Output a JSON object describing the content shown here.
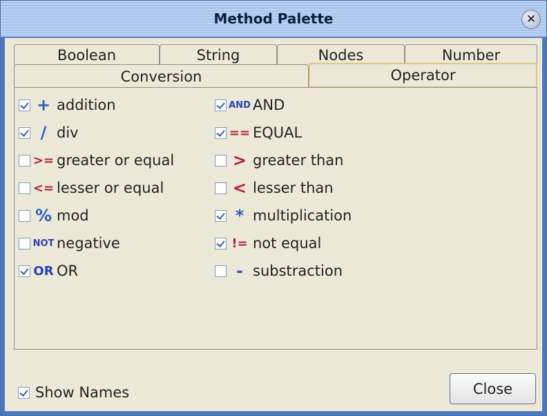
{
  "window": {
    "title": "Method Palette"
  },
  "tabs_row1": [
    "Boolean",
    "String",
    "Nodes",
    "Number"
  ],
  "tabs_row2": [
    "Conversion",
    "Operator"
  ],
  "selected_tab": "Operator",
  "left_items": [
    {
      "icon": "+",
      "icon_name": "plus-icon",
      "label": "addition",
      "checked": true,
      "color": "#2f5fc4"
    },
    {
      "icon": "/",
      "icon_name": "slash-icon",
      "label": "div",
      "checked": true,
      "color": "#2f5fc4"
    },
    {
      "icon": ">=",
      "icon_name": "greater-equal-icon",
      "label": "greater or equal",
      "checked": false,
      "color": "#b0203a"
    },
    {
      "icon": "<=",
      "icon_name": "lesser-equal-icon",
      "label": "lesser or equal",
      "checked": false,
      "color": "#b0203a"
    },
    {
      "icon": "%",
      "icon_name": "percent-icon",
      "label": "mod",
      "checked": false,
      "color": "#2f5fc4"
    },
    {
      "icon": "NOT",
      "icon_name": "not-icon",
      "label": "negative",
      "checked": false,
      "color": "#2a3fb0"
    },
    {
      "icon": "OR",
      "icon_name": "or-icon",
      "label": "OR",
      "checked": true,
      "color": "#2a3fb0"
    }
  ],
  "right_items": [
    {
      "icon": "AND",
      "icon_name": "and-icon",
      "label": "AND",
      "checked": true,
      "color": "#2a3fb0"
    },
    {
      "icon": "==",
      "icon_name": "equal-icon",
      "label": "EQUAL",
      "checked": true,
      "color": "#b0203a"
    },
    {
      "icon": ">",
      "icon_name": "greater-than-icon",
      "label": "greater than",
      "checked": false,
      "color": "#b0203a"
    },
    {
      "icon": "<",
      "icon_name": "lesser-than-icon",
      "label": "lesser than",
      "checked": false,
      "color": "#b0203a"
    },
    {
      "icon": "*",
      "icon_name": "asterisk-icon",
      "label": "multiplication",
      "checked": true,
      "color": "#2f5fc4"
    },
    {
      "icon": "!=",
      "icon_name": "not-equal-icon",
      "label": "not equal",
      "checked": true,
      "color": "#b0203a"
    },
    {
      "icon": "-",
      "icon_name": "minus-icon",
      "label": "substraction",
      "checked": false,
      "color": "#2f5fc4"
    }
  ],
  "footer": {
    "show_names_label": "Show Names",
    "show_names_checked": true,
    "close_label": "Close"
  }
}
